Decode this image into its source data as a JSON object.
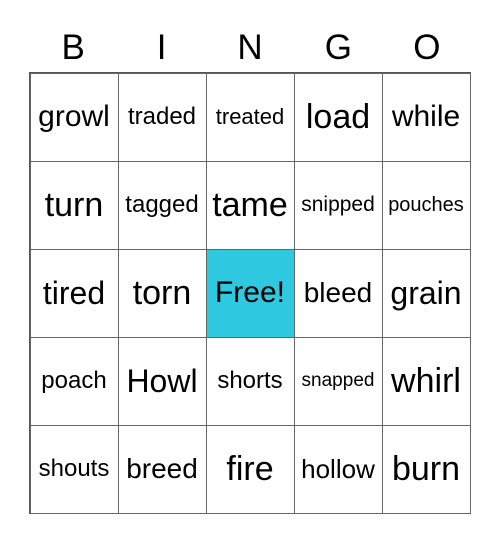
{
  "header": {
    "letters": [
      "B",
      "I",
      "N",
      "G",
      "O"
    ]
  },
  "card": {
    "free_color": "#2ec8e0",
    "rows": [
      [
        "growl",
        "traded",
        "treated",
        "load",
        "while"
      ],
      [
        "turn",
        "tagged",
        "tame",
        "snipped",
        "pouches"
      ],
      [
        "tired",
        "torn",
        "Free!",
        "bleed",
        "grain"
      ],
      [
        "poach",
        "Howl",
        "shorts",
        "snapped",
        "whirl"
      ],
      [
        "shouts",
        "breed",
        "fire",
        "hollow",
        "burn"
      ]
    ]
  }
}
